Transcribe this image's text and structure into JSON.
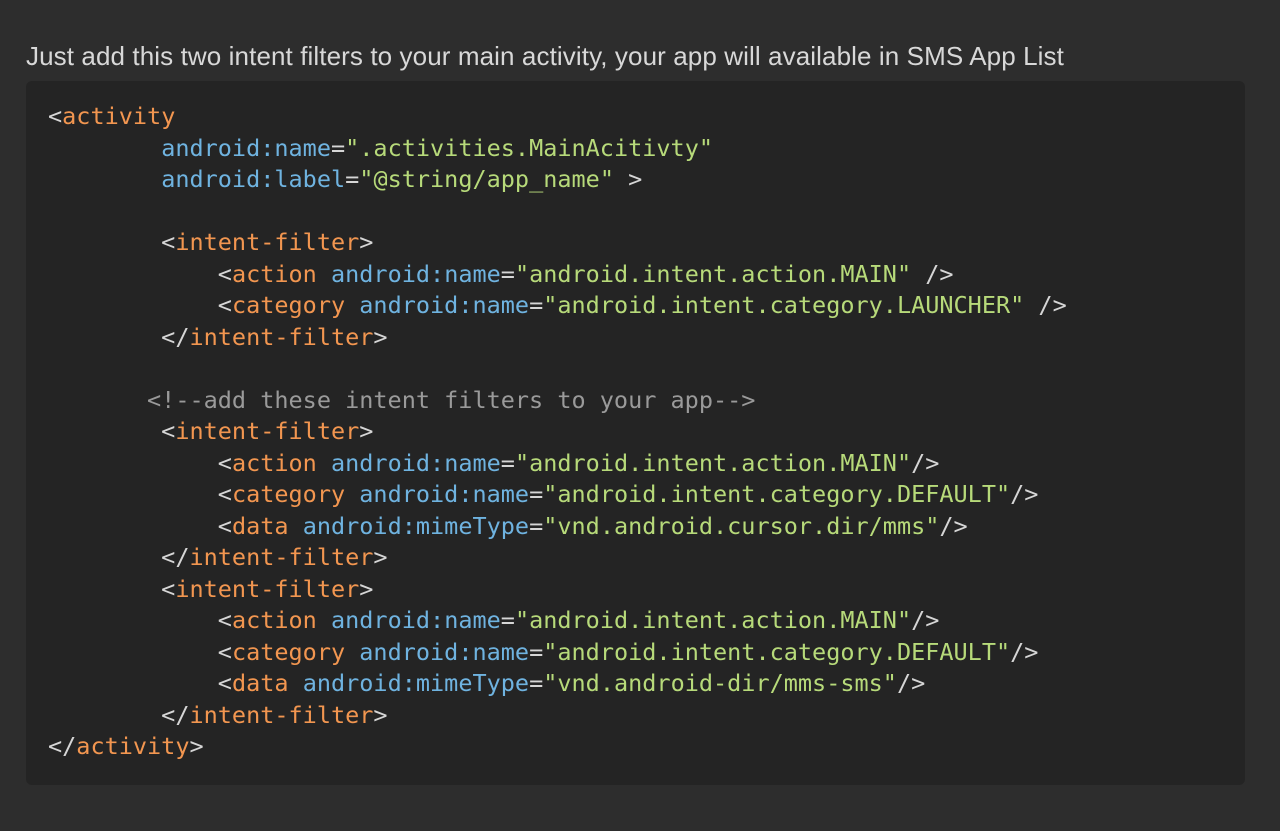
{
  "intro": {
    "text": "Just add this two intent filters to your main activity, your app will available in SMS App List"
  },
  "code_block": {
    "language": "xml",
    "colors": {
      "background": "#242424",
      "page_background": "#2d2d2d",
      "punctuation": "#d6d6d6",
      "tag": "#f29650",
      "attribute": "#6fb3e0",
      "string": "#b7da7a",
      "comment": "#9a9a9a"
    },
    "lines": [
      [
        {
          "t": "punc",
          "v": "<"
        },
        {
          "t": "tag",
          "v": "activity"
        }
      ],
      [
        {
          "t": "punc",
          "v": "        "
        },
        {
          "t": "ns",
          "v": "android"
        },
        {
          "t": "colon",
          "v": ":"
        },
        {
          "t": "attr",
          "v": "name"
        },
        {
          "t": "punc",
          "v": "="
        },
        {
          "t": "str",
          "v": "\".activities.MainAcitivty\""
        }
      ],
      [
        {
          "t": "punc",
          "v": "        "
        },
        {
          "t": "ns",
          "v": "android"
        },
        {
          "t": "colon",
          "v": ":"
        },
        {
          "t": "attr",
          "v": "label"
        },
        {
          "t": "punc",
          "v": "="
        },
        {
          "t": "str",
          "v": "\"@string/app_name\""
        },
        {
          "t": "punc",
          "v": " >"
        }
      ],
      [],
      [
        {
          "t": "punc",
          "v": "        <"
        },
        {
          "t": "tag",
          "v": "intent-filter"
        },
        {
          "t": "punc",
          "v": ">"
        }
      ],
      [
        {
          "t": "punc",
          "v": "            <"
        },
        {
          "t": "tag",
          "v": "action"
        },
        {
          "t": "punc",
          "v": " "
        },
        {
          "t": "ns",
          "v": "android"
        },
        {
          "t": "colon",
          "v": ":"
        },
        {
          "t": "attr",
          "v": "name"
        },
        {
          "t": "punc",
          "v": "="
        },
        {
          "t": "str",
          "v": "\"android.intent.action.MAIN\""
        },
        {
          "t": "punc",
          "v": " />"
        }
      ],
      [
        {
          "t": "punc",
          "v": "            <"
        },
        {
          "t": "tag",
          "v": "category"
        },
        {
          "t": "punc",
          "v": " "
        },
        {
          "t": "ns",
          "v": "android"
        },
        {
          "t": "colon",
          "v": ":"
        },
        {
          "t": "attr",
          "v": "name"
        },
        {
          "t": "punc",
          "v": "="
        },
        {
          "t": "str",
          "v": "\"android.intent.category.LAUNCHER\""
        },
        {
          "t": "punc",
          "v": " />"
        }
      ],
      [
        {
          "t": "punc",
          "v": "        </"
        },
        {
          "t": "tag",
          "v": "intent-filter"
        },
        {
          "t": "punc",
          "v": ">"
        }
      ],
      [],
      [
        {
          "t": "com",
          "v": "       <!--add these intent filters to your app-->"
        }
      ],
      [
        {
          "t": "punc",
          "v": "        <"
        },
        {
          "t": "tag",
          "v": "intent-filter"
        },
        {
          "t": "punc",
          "v": ">"
        }
      ],
      [
        {
          "t": "punc",
          "v": "            <"
        },
        {
          "t": "tag",
          "v": "action"
        },
        {
          "t": "punc",
          "v": " "
        },
        {
          "t": "ns",
          "v": "android"
        },
        {
          "t": "colon",
          "v": ":"
        },
        {
          "t": "attr",
          "v": "name"
        },
        {
          "t": "punc",
          "v": "="
        },
        {
          "t": "str",
          "v": "\"android.intent.action.MAIN\""
        },
        {
          "t": "punc",
          "v": "/>"
        }
      ],
      [
        {
          "t": "punc",
          "v": "            <"
        },
        {
          "t": "tag",
          "v": "category"
        },
        {
          "t": "punc",
          "v": " "
        },
        {
          "t": "ns",
          "v": "android"
        },
        {
          "t": "colon",
          "v": ":"
        },
        {
          "t": "attr",
          "v": "name"
        },
        {
          "t": "punc",
          "v": "="
        },
        {
          "t": "str",
          "v": "\"android.intent.category.DEFAULT\""
        },
        {
          "t": "punc",
          "v": "/>"
        }
      ],
      [
        {
          "t": "punc",
          "v": "            <"
        },
        {
          "t": "tag",
          "v": "data"
        },
        {
          "t": "punc",
          "v": " "
        },
        {
          "t": "ns",
          "v": "android"
        },
        {
          "t": "colon",
          "v": ":"
        },
        {
          "t": "attr",
          "v": "mimeType"
        },
        {
          "t": "punc",
          "v": "="
        },
        {
          "t": "str",
          "v": "\"vnd.android.cursor.dir/mms\""
        },
        {
          "t": "punc",
          "v": "/>"
        }
      ],
      [
        {
          "t": "punc",
          "v": "        </"
        },
        {
          "t": "tag",
          "v": "intent-filter"
        },
        {
          "t": "punc",
          "v": ">"
        }
      ],
      [
        {
          "t": "punc",
          "v": "        <"
        },
        {
          "t": "tag",
          "v": "intent-filter"
        },
        {
          "t": "punc",
          "v": ">"
        }
      ],
      [
        {
          "t": "punc",
          "v": "            <"
        },
        {
          "t": "tag",
          "v": "action"
        },
        {
          "t": "punc",
          "v": " "
        },
        {
          "t": "ns",
          "v": "android"
        },
        {
          "t": "colon",
          "v": ":"
        },
        {
          "t": "attr",
          "v": "name"
        },
        {
          "t": "punc",
          "v": "="
        },
        {
          "t": "str",
          "v": "\"android.intent.action.MAIN\""
        },
        {
          "t": "punc",
          "v": "/>"
        }
      ],
      [
        {
          "t": "punc",
          "v": "            <"
        },
        {
          "t": "tag",
          "v": "category"
        },
        {
          "t": "punc",
          "v": " "
        },
        {
          "t": "ns",
          "v": "android"
        },
        {
          "t": "colon",
          "v": ":"
        },
        {
          "t": "attr",
          "v": "name"
        },
        {
          "t": "punc",
          "v": "="
        },
        {
          "t": "str",
          "v": "\"android.intent.category.DEFAULT\""
        },
        {
          "t": "punc",
          "v": "/>"
        }
      ],
      [
        {
          "t": "punc",
          "v": "            <"
        },
        {
          "t": "tag",
          "v": "data"
        },
        {
          "t": "punc",
          "v": " "
        },
        {
          "t": "ns",
          "v": "android"
        },
        {
          "t": "colon",
          "v": ":"
        },
        {
          "t": "attr",
          "v": "mimeType"
        },
        {
          "t": "punc",
          "v": "="
        },
        {
          "t": "str",
          "v": "\"vnd.android-dir/mms-sms\""
        },
        {
          "t": "punc",
          "v": "/>"
        }
      ],
      [
        {
          "t": "punc",
          "v": "        </"
        },
        {
          "t": "tag",
          "v": "intent-filter"
        },
        {
          "t": "punc",
          "v": ">"
        }
      ],
      [
        {
          "t": "punc",
          "v": "</"
        },
        {
          "t": "tag",
          "v": "activity"
        },
        {
          "t": "punc",
          "v": ">"
        }
      ]
    ]
  }
}
